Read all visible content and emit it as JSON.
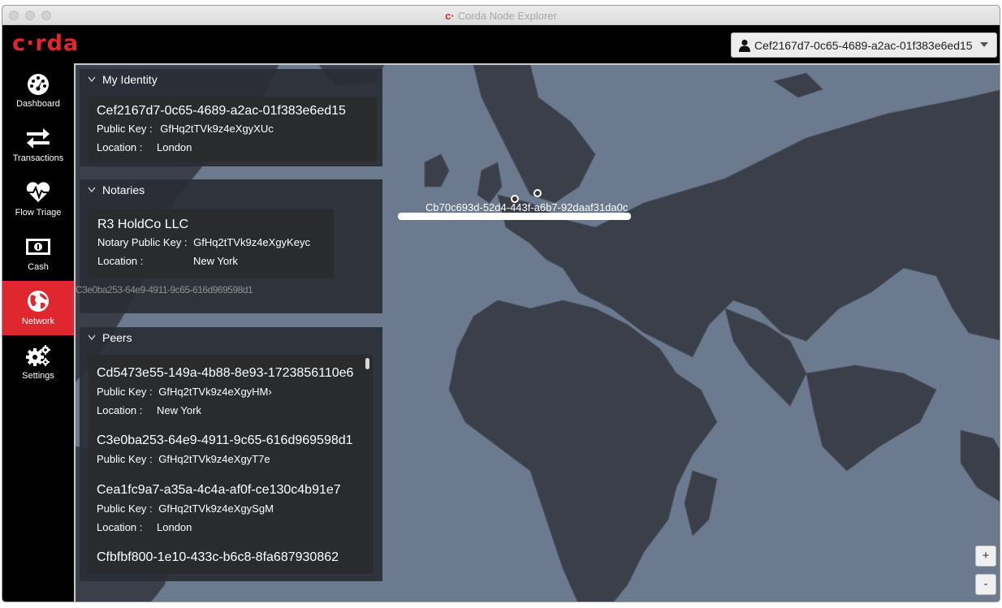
{
  "window": {
    "title": "Corda Node Explorer"
  },
  "header": {
    "logo": "c·rda",
    "identity_selector": "Cef2167d7-0c65-4689-a2ac-01f383e6ed15"
  },
  "sidebar": {
    "items": [
      {
        "label": "Dashboard",
        "icon": "dashboard-icon"
      },
      {
        "label": "Transactions",
        "icon": "transactions-icon"
      },
      {
        "label": "Flow Triage",
        "icon": "heart-pulse-icon"
      },
      {
        "label": "Cash",
        "icon": "cash-icon"
      },
      {
        "label": "Network",
        "icon": "globe-icon",
        "active": true
      },
      {
        "label": "Settings",
        "icon": "gears-icon"
      }
    ]
  },
  "my_identity": {
    "title": "My Identity",
    "name": "Cef2167d7-0c65-4689-a2ac-01f383e6ed15",
    "public_key_label": "Public Key :",
    "public_key": "GfHq2tTVk9z4eXgyXUc",
    "location_label": "Location :",
    "location": "London"
  },
  "notaries": {
    "title": "Notaries",
    "name": "R3 HoldCo LLC",
    "public_key_label": "Notary Public Key :",
    "public_key": "GfHq2tTVk9z4eXgyKeyc",
    "location_label": "Location :",
    "location": "New York"
  },
  "peers": {
    "title": "Peers",
    "items": [
      {
        "name": "Cd5473e55-149a-4b88-8e93-1723856110e6",
        "public_key_label": "Public Key :",
        "public_key": "GfHq2tTVk9z4eXgyHM›",
        "location_label": "Location :",
        "location": "New York"
      },
      {
        "name": "C3e0ba253-64e9-4911-9c65-616d969598d1",
        "public_key_label": "Public Key :",
        "public_key": "GfHq2tTVk9z4eXgyT7e",
        "location_label": "",
        "location": ""
      },
      {
        "name": "Cea1fc9a7-a35a-4c4a-af0f-ce130c4b91e7",
        "public_key_label": "Public Key :",
        "public_key": "GfHq2tTVk9z4eXgySgM",
        "location_label": "Location :",
        "location": "London"
      },
      {
        "name": "Cfbfbf800-1e10-433c-b6c8-8fa687930862",
        "public_key_label": "",
        "public_key": "",
        "location_label": "",
        "location": ""
      }
    ]
  },
  "map": {
    "marker_label": "Cb70c693d-52d4-443f-a6b7-92daaf31da0c",
    "ghost_label": "C3e0ba253-64e9-4911-9c65-616d969598d1",
    "zoom_in": "+",
    "zoom_out": "-",
    "land_color": "#3a3f4a",
    "sea_color": "#6b7a8e"
  },
  "colors": {
    "accent": "#e0262f"
  }
}
